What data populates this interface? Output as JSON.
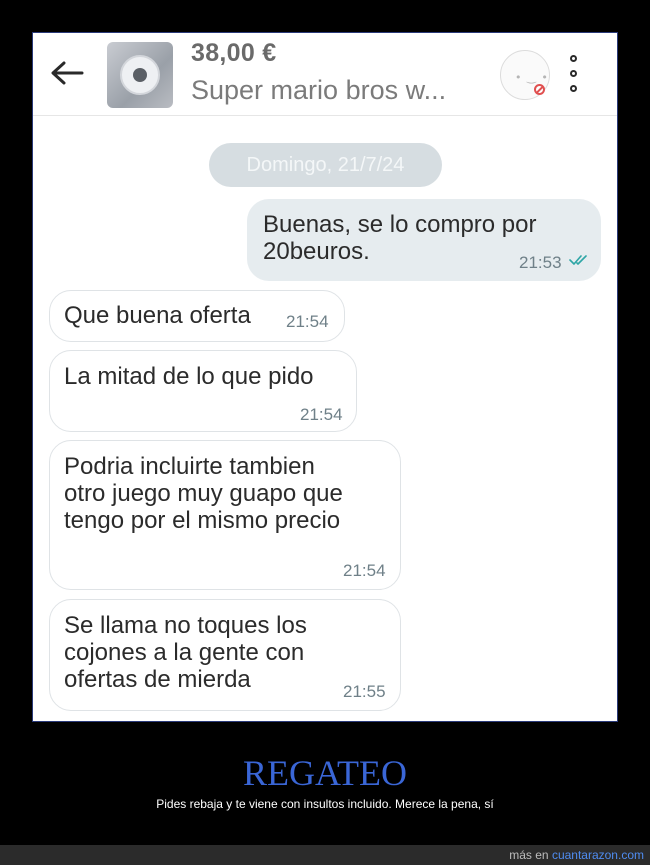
{
  "header": {
    "price": "38,00 €",
    "item_title": "Super mario bros w..."
  },
  "chat": {
    "date_separator": "Domingo, 21/7/24",
    "messages": [
      {
        "direction": "outgoing",
        "text": "Buenas, se lo compro por 20beuros.",
        "line1": "Buenas, se lo compro por",
        "line2": "20beuros.",
        "time": "21:53",
        "read": true
      },
      {
        "direction": "incoming",
        "text": "Que buena oferta",
        "time": "21:54"
      },
      {
        "direction": "incoming",
        "text": "La mitad de lo que pido",
        "time": "21:54"
      },
      {
        "direction": "incoming",
        "text": "Podria incluirte tambien otro juego muy guapo que tengo por el mismo precio",
        "line1": "Podria incluirte tambien",
        "line2": "otro juego muy guapo que",
        "line3": "tengo por el mismo precio",
        "time": "21:54"
      },
      {
        "direction": "incoming",
        "text": "Se llama no toques los cojones a la gente con ofertas de mierda",
        "line1": "Se llama no toques los",
        "line2": "cojones a la gente con",
        "line3": "ofertas de mierda",
        "time": "21:55"
      }
    ]
  },
  "caption": {
    "title": "REGATEO",
    "text": "Pides rebaja y te viene con insultos incluido. Merece la pena, sí"
  },
  "footer": {
    "prefix": "más en",
    "site": "cuantarazon.com"
  },
  "colors": {
    "read_ticks": "#2ea6a6",
    "caption_title": "#3a66d6",
    "link": "#4f8cf0"
  },
  "icons": [
    "back-arrow-icon",
    "product-thumbnail",
    "user-avatar-icon",
    "blocked-icon",
    "more-options-icon",
    "double-check-icon"
  ]
}
